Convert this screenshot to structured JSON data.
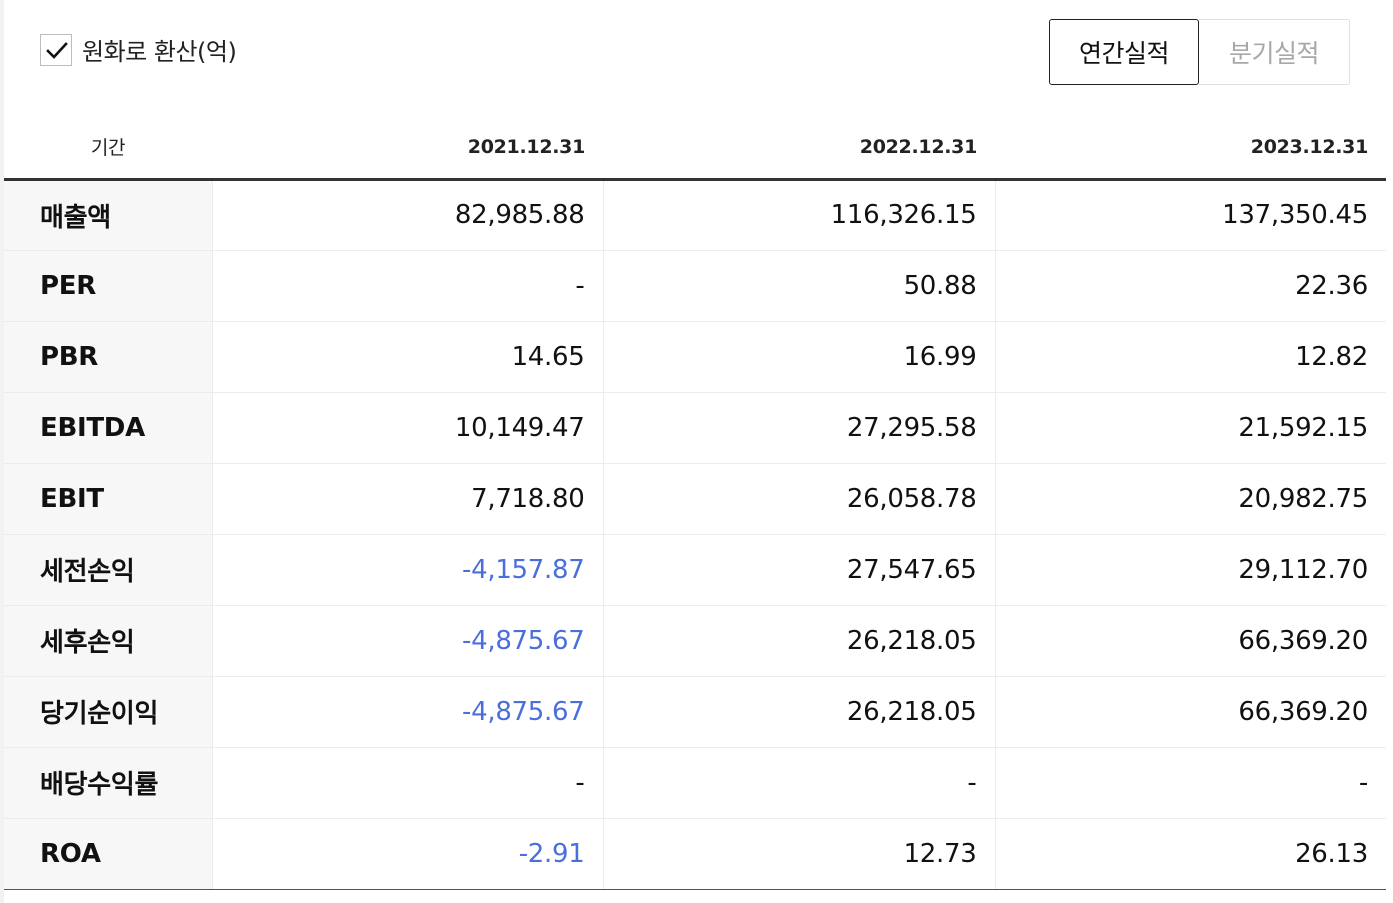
{
  "toolbar": {
    "krw_convert_label": "원화로 환산(억)",
    "krw_convert_checked": true,
    "annual_label": "연간실적",
    "quarterly_label": "분기실적",
    "active_period": "annual"
  },
  "table": {
    "period_header": "기간",
    "columns": [
      "2021.12.31",
      "2022.12.31",
      "2023.12.31"
    ],
    "rows": [
      {
        "label": "매출액",
        "values": [
          "82,985.88",
          "116,326.15",
          "137,350.45"
        ]
      },
      {
        "label": "PER",
        "values": [
          "-",
          "50.88",
          "22.36"
        ]
      },
      {
        "label": "PBR",
        "values": [
          "14.65",
          "16.99",
          "12.82"
        ]
      },
      {
        "label": "EBITDA",
        "values": [
          "10,149.47",
          "27,295.58",
          "21,592.15"
        ]
      },
      {
        "label": "EBIT",
        "values": [
          "7,718.80",
          "26,058.78",
          "20,982.75"
        ]
      },
      {
        "label": "세전손익",
        "values": [
          "-4,157.87",
          "27,547.65",
          "29,112.70"
        ]
      },
      {
        "label": "세후손익",
        "values": [
          "-4,875.67",
          "26,218.05",
          "66,369.20"
        ]
      },
      {
        "label": "당기순이익",
        "values": [
          "-4,875.67",
          "26,218.05",
          "66,369.20"
        ]
      },
      {
        "label": "배당수익률",
        "values": [
          "-",
          "-",
          "-"
        ]
      },
      {
        "label": "ROA",
        "values": [
          "-2.91",
          "12.73",
          "26.13"
        ]
      }
    ]
  },
  "colors": {
    "negative_value": "#4a6fdc",
    "header_rule": "#333333",
    "row_label_bg": "#f7f7f7"
  }
}
